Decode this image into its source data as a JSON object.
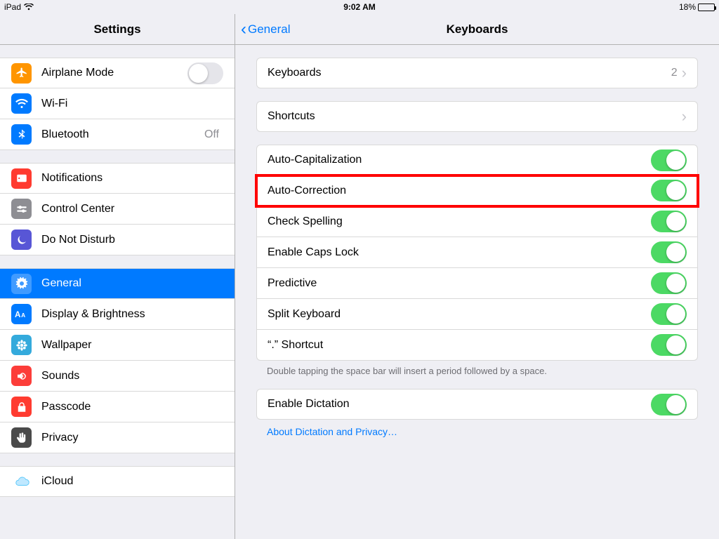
{
  "statusbar": {
    "device": "iPad",
    "time": "9:02 AM",
    "battery_pct": "18%"
  },
  "sidebar": {
    "title": "Settings",
    "groups": [
      [
        {
          "id": "airplane",
          "label": "Airplane Mode",
          "icon": "airplane",
          "color": "bg-orange",
          "kind": "toggle",
          "on": false
        },
        {
          "id": "wifi",
          "label": "Wi-Fi",
          "icon": "wifi",
          "color": "bg-blue",
          "kind": "link"
        },
        {
          "id": "bluetooth",
          "label": "Bluetooth",
          "icon": "bluetooth",
          "color": "bg-blue",
          "kind": "link",
          "trail": "Off"
        }
      ],
      [
        {
          "id": "notifications",
          "label": "Notifications",
          "icon": "notif",
          "color": "bg-red",
          "kind": "link"
        },
        {
          "id": "controlcenter",
          "label": "Control Center",
          "icon": "cc",
          "color": "bg-gray",
          "kind": "link"
        },
        {
          "id": "dnd",
          "label": "Do Not Disturb",
          "icon": "moon",
          "color": "bg-purple",
          "kind": "link"
        }
      ],
      [
        {
          "id": "general",
          "label": "General",
          "icon": "gear",
          "color": "bg-gray",
          "kind": "link",
          "selected": true
        },
        {
          "id": "display",
          "label": "Display & Brightness",
          "icon": "aa",
          "color": "bg-blue",
          "kind": "link"
        },
        {
          "id": "wallpaper",
          "label": "Wallpaper",
          "icon": "flower",
          "color": "bg-cyan",
          "kind": "link"
        },
        {
          "id": "sounds",
          "label": "Sounds",
          "icon": "speaker",
          "color": "bg-red2",
          "kind": "link"
        },
        {
          "id": "passcode",
          "label": "Passcode",
          "icon": "lock",
          "color": "bg-red",
          "kind": "link"
        },
        {
          "id": "privacy",
          "label": "Privacy",
          "icon": "hand",
          "color": "bg-darkgray",
          "kind": "link"
        }
      ],
      [
        {
          "id": "icloud",
          "label": "iCloud",
          "icon": "cloud",
          "color": "",
          "kind": "link"
        }
      ]
    ]
  },
  "detail": {
    "back": "General",
    "title": "Keyboards",
    "groups": [
      {
        "rows": [
          {
            "id": "keyboards",
            "label": "Keyboards",
            "kind": "link",
            "trail": "2"
          }
        ]
      },
      {
        "rows": [
          {
            "id": "shortcuts",
            "label": "Shortcuts",
            "kind": "link"
          }
        ]
      },
      {
        "rows": [
          {
            "id": "autocap",
            "label": "Auto-Capitalization",
            "kind": "toggle",
            "on": true
          },
          {
            "id": "autocorr",
            "label": "Auto-Correction",
            "kind": "toggle",
            "on": true,
            "highlight": true
          },
          {
            "id": "spell",
            "label": "Check Spelling",
            "kind": "toggle",
            "on": true
          },
          {
            "id": "capslock",
            "label": "Enable Caps Lock",
            "kind": "toggle",
            "on": true
          },
          {
            "id": "predict",
            "label": "Predictive",
            "kind": "toggle",
            "on": true
          },
          {
            "id": "split",
            "label": "Split Keyboard",
            "kind": "toggle",
            "on": true
          },
          {
            "id": "period",
            "label": "“.” Shortcut",
            "kind": "toggle",
            "on": true
          }
        ],
        "footer": "Double tapping the space bar will insert a period followed by a space."
      },
      {
        "rows": [
          {
            "id": "dictation",
            "label": "Enable Dictation",
            "kind": "toggle",
            "on": true
          }
        ],
        "link": "About Dictation and Privacy…"
      }
    ]
  }
}
